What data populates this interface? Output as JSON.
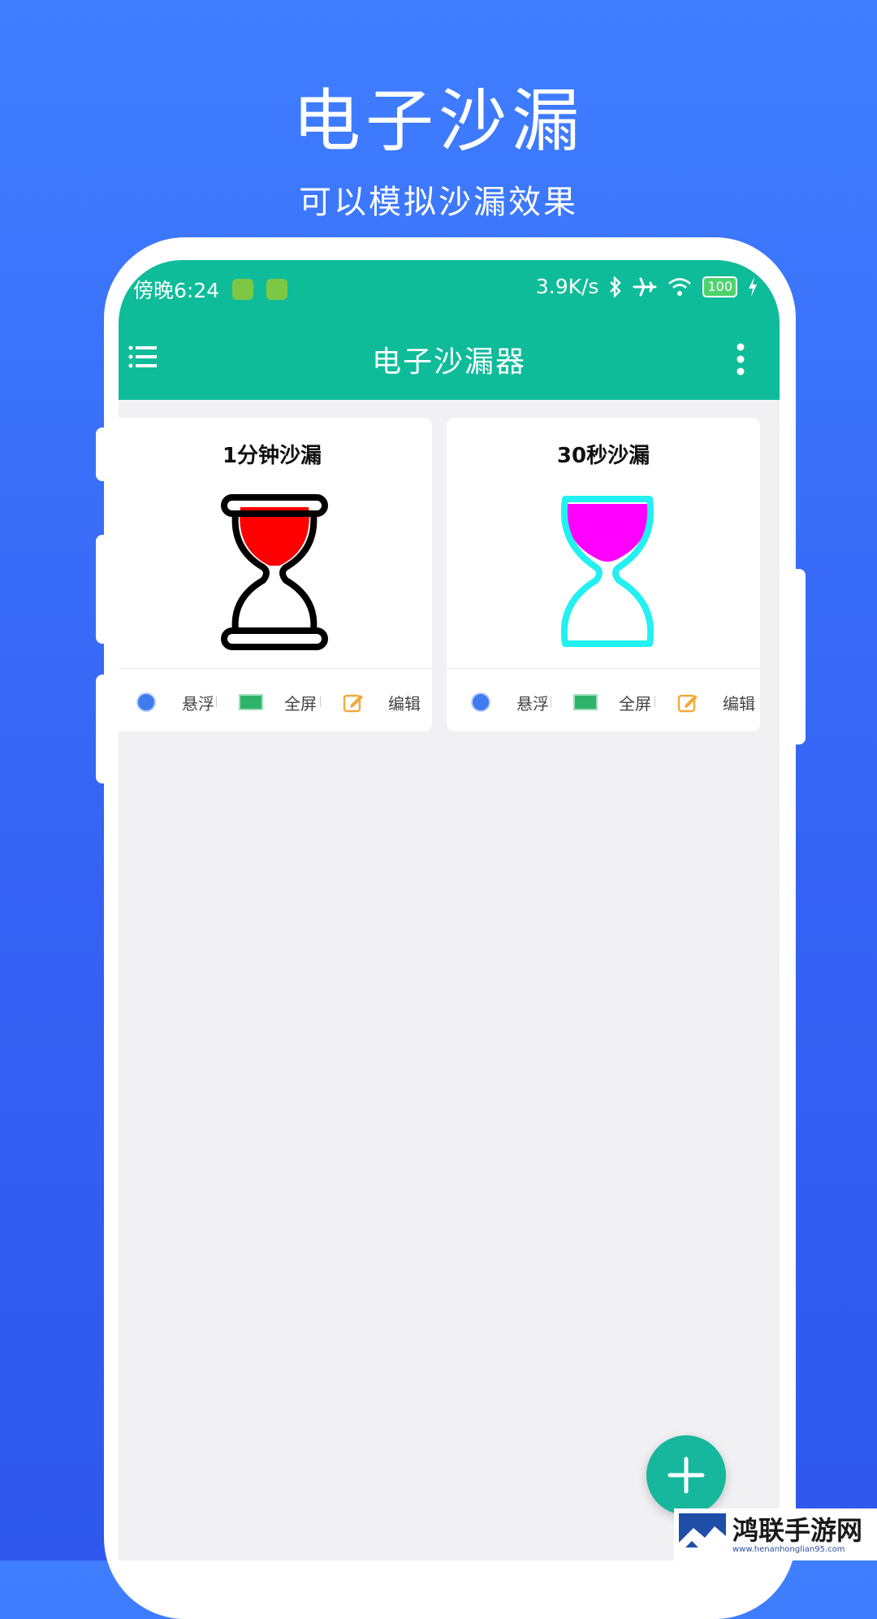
{
  "promo": {
    "title": "电子沙漏",
    "subtitle": "可以模拟沙漏效果"
  },
  "status_bar": {
    "time": "傍晚6:24",
    "network_speed": "3.9K/s",
    "battery": "100",
    "icons": [
      "app-notification-icon",
      "app-notification-icon",
      "bluetooth-icon",
      "airplane-icon",
      "wifi-icon",
      "battery-icon",
      "charging-icon"
    ]
  },
  "app_bar": {
    "title": "电子沙漏器",
    "menu_icon": "menu-icon",
    "more_icon": "more-vertical-icon"
  },
  "cards": [
    {
      "title": "1分钟沙漏",
      "sand_color": "#ff0000",
      "frame_color": "#000000",
      "actions": [
        {
          "label": "悬浮",
          "icon": "circle-float-icon"
        },
        {
          "label": "全屏",
          "icon": "fullscreen-rect-icon"
        },
        {
          "label": "编辑",
          "icon": "edit-icon"
        }
      ]
    },
    {
      "title": "30秒沙漏",
      "sand_color": "#ff00ff",
      "frame_color": "#23f0f0",
      "actions": [
        {
          "label": "悬浮",
          "icon": "circle-float-icon"
        },
        {
          "label": "全屏",
          "icon": "fullscreen-rect-icon"
        },
        {
          "label": "编辑",
          "icon": "edit-icon"
        }
      ]
    }
  ],
  "fab": {
    "icon": "plus-icon"
  },
  "watermark": {
    "text": "鸿联手游网",
    "url": "www.henanhonglian95.com"
  },
  "colors": {
    "background": "#3a6ffa",
    "app_bar": "#0fbc99",
    "fab": "#16b79c"
  }
}
